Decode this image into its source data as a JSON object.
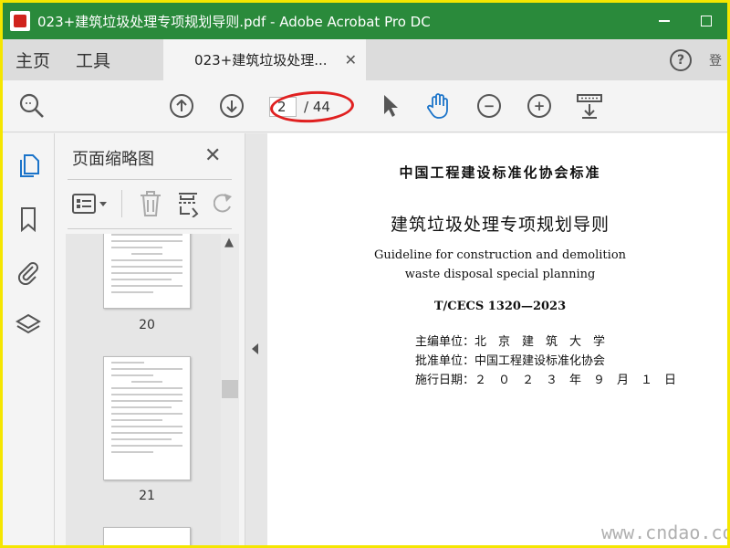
{
  "window": {
    "title": "023+建筑垃圾处理专项规划导则.pdf - Adobe Acrobat Pro DC"
  },
  "tabs": {
    "home": "主页",
    "tools": "工具",
    "doc_tab": "023+建筑垃圾处理...",
    "edge_glyph": "登"
  },
  "toolbar": {
    "current_page": "2",
    "total_pages": "/ 44"
  },
  "thumbnails": {
    "title": "页面缩略图",
    "pages": [
      "20",
      "21"
    ]
  },
  "document": {
    "org_title": "中国工程建设标准化协会标准",
    "main_title": "建筑垃圾处理专项规划导则",
    "en_title_1": "Guideline for construction and demolition",
    "en_title_2": "waste disposal special planning",
    "code": "T/CECS 1320—2023",
    "editor_line": "主编单位：北　京　建　筑　大　学",
    "approver_line": "批准单位：中国工程建设标准化协会",
    "date_line": "施行日期：２　０　２　３　年　９　月　１　日"
  },
  "watermark": {
    "text": "www.cndao.com"
  },
  "colors": {
    "titlebar": "#2a8a3b",
    "highlight_ellipse": "#e02020",
    "active_icon": "#1a73c9"
  }
}
